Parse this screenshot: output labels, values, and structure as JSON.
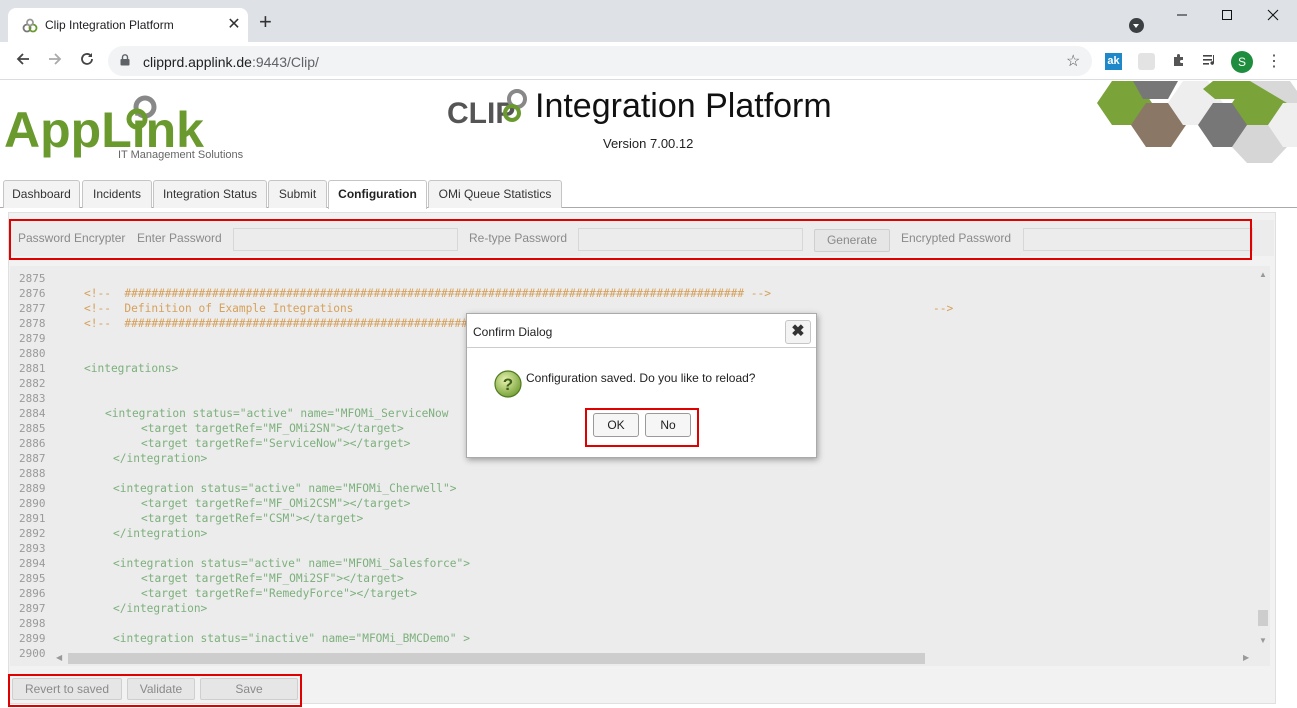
{
  "browser": {
    "tab_title": "Clip Integration Platform",
    "tab_close": "✕",
    "new_tab": "+",
    "url_host": "clipprd.applink.de",
    "url_rest": ":9443/Clip/",
    "avatar_letter": "S",
    "ext_label": "ak"
  },
  "header": {
    "logo_text": "AppLink",
    "logo_subtitle": "IT Management Solutions",
    "clip_logo_text": "CLIP",
    "title": "Integration Platform",
    "version": "Version 7.00.12"
  },
  "tabs": [
    {
      "label": "Dashboard"
    },
    {
      "label": "Incidents"
    },
    {
      "label": "Integration Status"
    },
    {
      "label": "Submit"
    },
    {
      "label": "Configuration"
    },
    {
      "label": "OMi Queue Statistics"
    }
  ],
  "password_encrypter": {
    "title": "Password Encrypter",
    "enter_label": "Enter Password",
    "retype_label": "Re-type Password",
    "generate_label": "Generate",
    "encrypted_label": "Encrypted Password"
  },
  "editor": {
    "lines": [
      {
        "n": "2875"
      },
      {
        "n": "2876"
      },
      {
        "n": "2877"
      },
      {
        "n": "2878"
      },
      {
        "n": "2879"
      },
      {
        "n": "2880"
      },
      {
        "n": "2881"
      },
      {
        "n": "2882"
      },
      {
        "n": "2883"
      },
      {
        "n": "2884"
      },
      {
        "n": "2885"
      },
      {
        "n": "2886"
      },
      {
        "n": "2887"
      },
      {
        "n": "2888"
      },
      {
        "n": "2889"
      },
      {
        "n": "2890"
      },
      {
        "n": "2891"
      },
      {
        "n": "2892"
      },
      {
        "n": "2893"
      },
      {
        "n": "2894"
      },
      {
        "n": "2895"
      },
      {
        "n": "2896"
      },
      {
        "n": "2897"
      },
      {
        "n": "2898"
      },
      {
        "n": "2899"
      },
      {
        "n": "2900"
      }
    ],
    "code": {
      "c2876": "<!--  ############################################################################################ -->",
      "c2877a": "<!--  Definition of Example Integrations",
      "c2877b": "-->",
      "c2878": "<!--  ############################################################################################ -->",
      "c2881": "<integrations>",
      "c2884": "<integration status=\"active\" name=\"MFOMi_ServiceNow",
      "c2885": "<target targetRef=\"MF_OMi2SN\"></target>",
      "c2886": "<target targetRef=\"ServiceNow\"></target>",
      "c2887": "</integration>",
      "c2889": "<integration status=\"active\" name=\"MFOMi_Cherwell\">",
      "c2890": "<target targetRef=\"MF_OMi2CSM\"></target>",
      "c2891": "<target targetRef=\"CSM\"></target>",
      "c2892": "</integration>",
      "c2894": "<integration status=\"active\" name=\"MFOMi_Salesforce\">",
      "c2895": "<target targetRef=\"MF_OMi2SF\"></target>",
      "c2896": "<target targetRef=\"RemedyForce\"></target>",
      "c2897": "</integration>",
      "c2899": "<integration status=\"inactive\" name=\"MFOMi_BMCDemo\" >"
    }
  },
  "footer": {
    "revert_label": "Revert to saved",
    "validate_label": "Validate",
    "save_label": "Save"
  },
  "dialog": {
    "title": "Confirm Dialog",
    "close": "✖",
    "message": "Configuration saved. Do you like to reload?",
    "ok_label": "OK",
    "no_label": "No"
  },
  "colors": {
    "highlight_frame": "#e00000",
    "applink_green": "#6a9a2e",
    "hex_green": "#7aa33a",
    "hex_gray": "#777777",
    "hex_brown": "#8b7765"
  }
}
